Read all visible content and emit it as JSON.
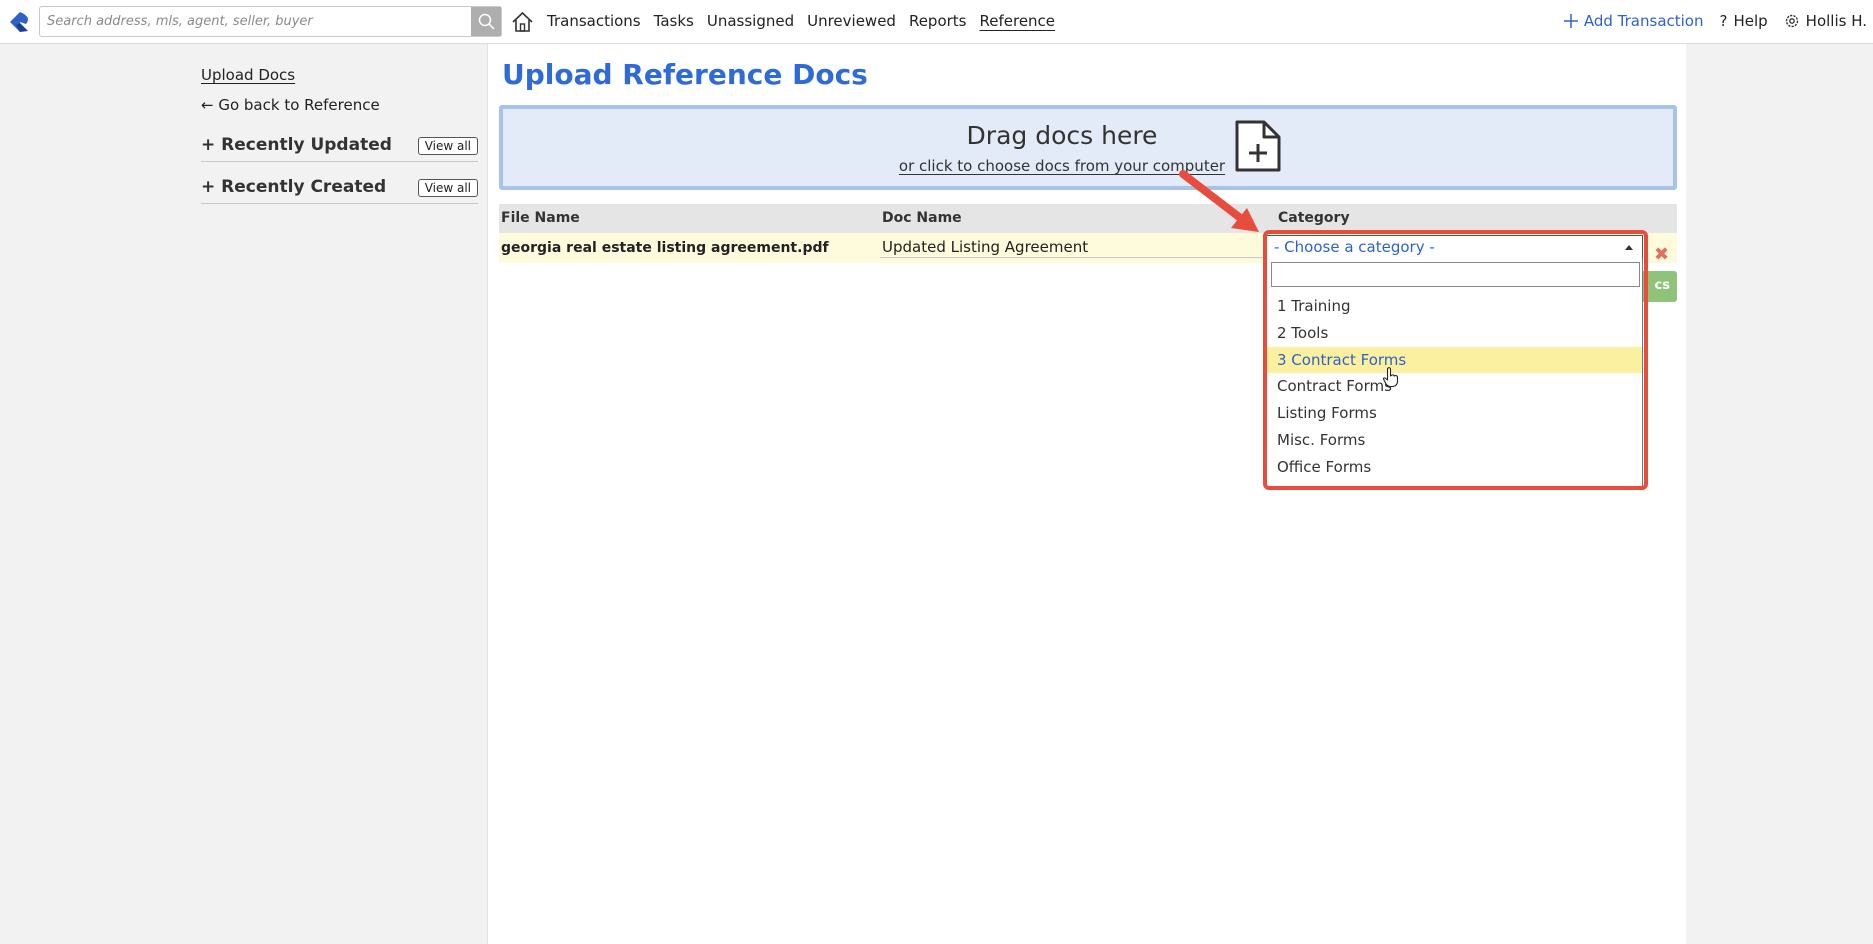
{
  "topbar": {
    "search_placeholder": "Search address, mls, agent, seller, buyer",
    "nav": [
      "Transactions",
      "Tasks",
      "Unassigned",
      "Unreviewed",
      "Reports",
      "Reference"
    ],
    "active_nav": "Reference",
    "add_transaction": "Add Transaction",
    "help": "Help",
    "user": "Hollis H."
  },
  "sidebar": {
    "upload_docs": "Upload Docs",
    "go_back": "Go back to Reference",
    "sections": [
      {
        "title": "Recently Updated",
        "button": "View all"
      },
      {
        "title": "Recently Created",
        "button": "View all"
      }
    ]
  },
  "main": {
    "title": "Upload Reference Docs",
    "dropzone": {
      "title": "Drag docs here",
      "subtitle": "or click to choose docs from your computer"
    },
    "table": {
      "headers": [
        "File Name",
        "Doc Name",
        "Category"
      ],
      "row": {
        "file_name": "georgia real estate listing agreement.pdf",
        "doc_name": "Updated Listing Agreement"
      }
    },
    "upload_button_visible_text": "cs"
  },
  "category_select": {
    "selected": "- Choose a category -",
    "options": [
      "1 Training",
      "2 Tools",
      "3 Contract Forms",
      "Contract Forms",
      "Listing Forms",
      "Misc. Forms",
      "Office Forms"
    ],
    "highlighted": "3 Contract Forms"
  },
  "colors": {
    "accent_blue": "#2f6bd8",
    "highlight_red": "#e84c3d",
    "dropzone_bg": "#e3ebf8",
    "row_bg": "#fdfbdc",
    "option_highlight": "#fbf09f",
    "button_green": "#8fc37a"
  }
}
